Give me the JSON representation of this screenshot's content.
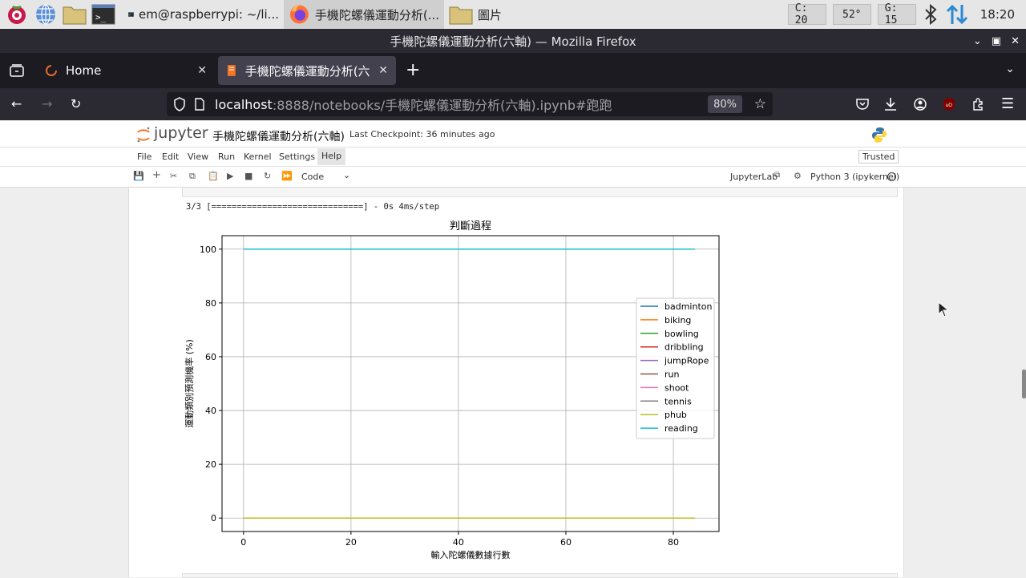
{
  "taskbar": {
    "tasks": [
      {
        "label": "em@raspberrypi: ~/li..."
      },
      {
        "label": "手機陀螺儀運動分析(..."
      },
      {
        "label": "圖片"
      }
    ],
    "cpu": "C: 20",
    "temp": "52°",
    "gpu": "G: 15",
    "clock": "18:20"
  },
  "window": {
    "title": "手機陀螺儀運動分析(六軸) — Mozilla Firefox"
  },
  "tabs": [
    {
      "label": "Home"
    },
    {
      "label": "手機陀螺儀運動分析(六軸"
    }
  ],
  "url": {
    "host": "localhost",
    "rest": ":8888/notebooks/手機陀螺儀運動分析(六軸).ipynb#跑跑",
    "zoom": "80%"
  },
  "jupyter": {
    "logo": "jupyter",
    "notebook_title": "手機陀螺儀運動分析(六軸)",
    "checkpoint": "Last Checkpoint: 36 minutes ago",
    "menu": [
      "File",
      "Edit",
      "View",
      "Run",
      "Kernel",
      "Settings",
      "Help"
    ],
    "trusted": "Trusted",
    "cell_type": "Code",
    "jupyterlab": "JupyterLab",
    "kernel": "Python 3 (ipykernel)"
  },
  "output": {
    "progress_line": "3/3 [==============================] - 0s 4ms/step"
  },
  "chart_data": {
    "type": "line",
    "title": "判斷過程",
    "xlabel": "輸入陀螺儀數據行數",
    "ylabel": "運動類別預測機率 (%)",
    "xlim": [
      -4,
      88.5
    ],
    "ylim": [
      -5,
      105
    ],
    "xticks": [
      0,
      20,
      40,
      60,
      80
    ],
    "yticks": [
      0,
      20,
      40,
      60,
      80,
      100
    ],
    "grid": true,
    "legend_position": "center-right",
    "x": [
      0,
      84
    ],
    "series": [
      {
        "name": "badminton",
        "color": "#1f77b4",
        "values": [
          0,
          0
        ]
      },
      {
        "name": "biking",
        "color": "#ff7f0e",
        "values": [
          0,
          0
        ]
      },
      {
        "name": "bowling",
        "color": "#2ca02c",
        "values": [
          0,
          0
        ]
      },
      {
        "name": "dribbling",
        "color": "#d62728",
        "values": [
          0,
          0
        ]
      },
      {
        "name": "jumpRope",
        "color": "#9467bd",
        "values": [
          0,
          0
        ]
      },
      {
        "name": "run",
        "color": "#8c564b",
        "values": [
          0,
          0
        ]
      },
      {
        "name": "shoot",
        "color": "#e377c2",
        "values": [
          0,
          0
        ]
      },
      {
        "name": "tennis",
        "color": "#7f7f7f",
        "values": [
          0,
          0
        ]
      },
      {
        "name": "phub",
        "color": "#bcbd22",
        "values": [
          0,
          0
        ]
      },
      {
        "name": "reading",
        "color": "#17becf",
        "values": [
          100,
          100
        ]
      }
    ]
  }
}
